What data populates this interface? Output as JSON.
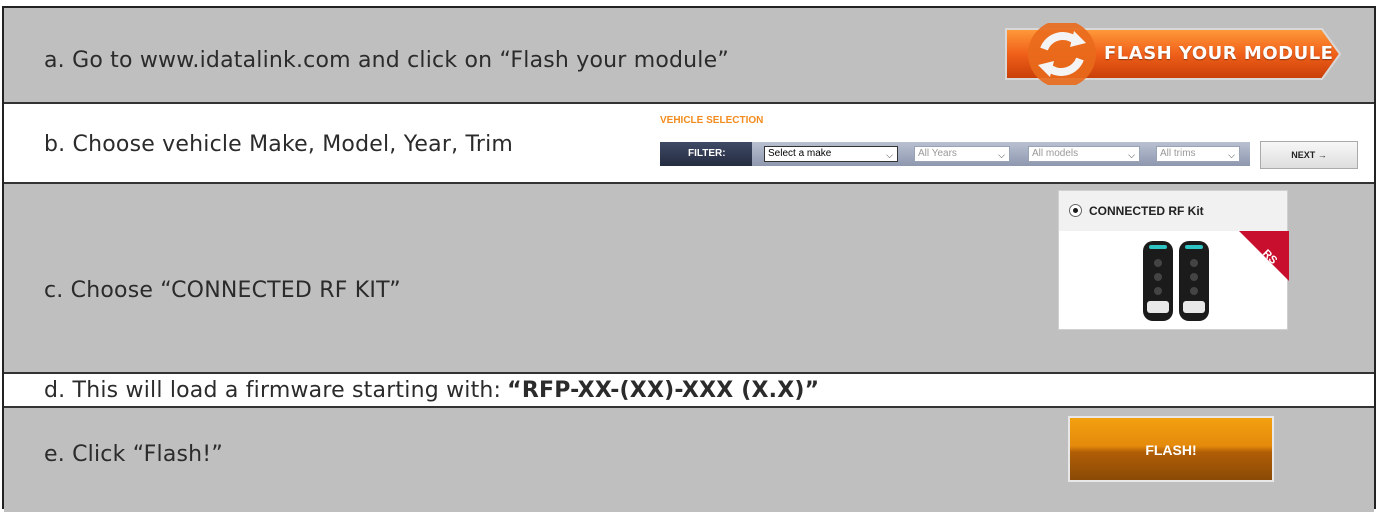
{
  "steps": {
    "a": {
      "text": "a. Go to www.idatalink.com and click on “Flash your module”"
    },
    "b": {
      "text": "b. Choose vehicle Make, Model, Year, Trim"
    },
    "c": {
      "text": "c. Choose “CONNECTED RF KIT”"
    },
    "d": {
      "text": "d. This will load a firmware starting with:",
      "firmware": "“RFP-XX-(XX)-XXX (X.X)”"
    },
    "e": {
      "text": "e. Click “Flash!”"
    }
  },
  "flash_module_button": {
    "label": "FLASH YOUR MODULE"
  },
  "vehicle_selection": {
    "title": "VEHICLE SELECTION",
    "filter_label": "FILTER:",
    "make_select": "Select a make",
    "years_select": "All Years",
    "models_select": "All models",
    "trims_select": "All trims",
    "next_label": "NEXT →"
  },
  "rf_kit": {
    "option_label": "CONNECTED RF Kit",
    "corner_badge": "RS"
  },
  "flash_button": {
    "label": "FLASH!"
  },
  "colors": {
    "row_gray": "#bfbfbf",
    "orange": "#f26a1b",
    "vs_title": "#f28c1e"
  }
}
